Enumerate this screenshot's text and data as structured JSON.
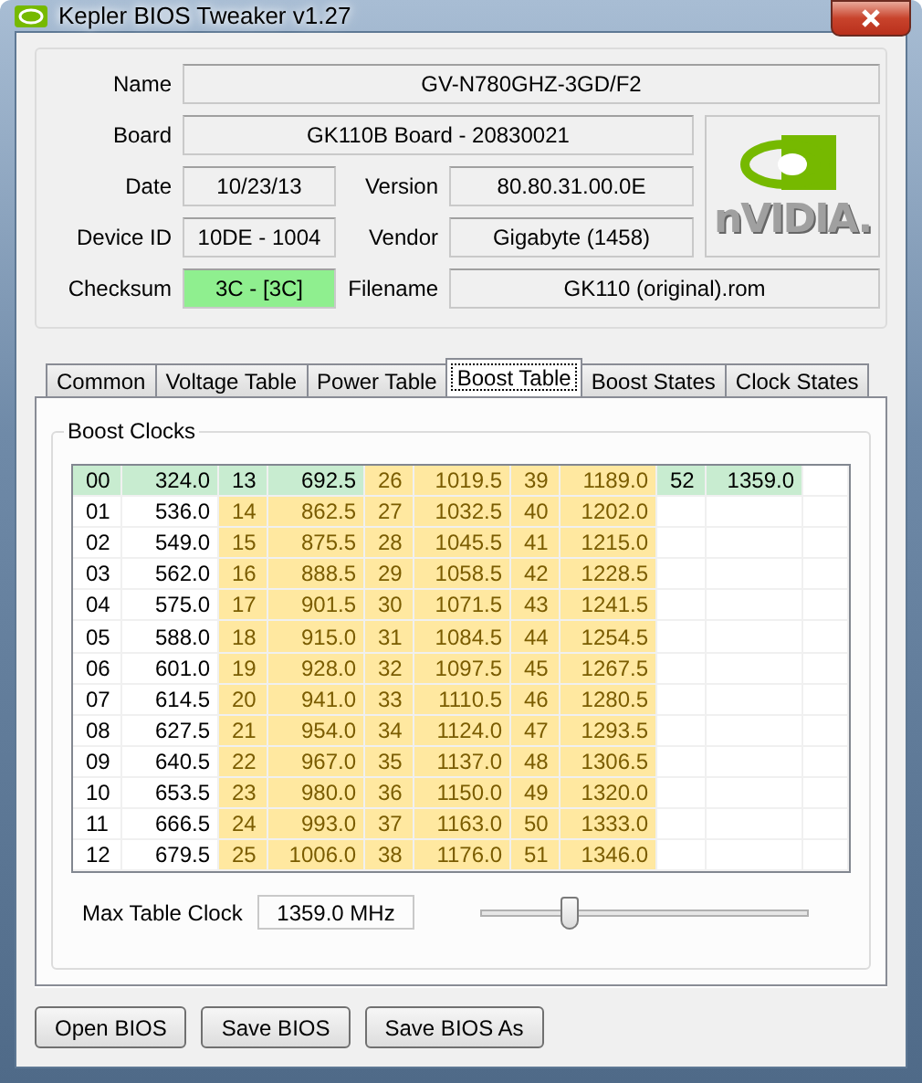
{
  "window": {
    "title": "Kepler BIOS Tweaker v1.27"
  },
  "fields": [
    {
      "label": "Name",
      "value": "GV-N780GHZ-3GD/F2",
      "highlighted": false
    },
    {
      "label": "Board",
      "value": "GK110B Board - 20830021",
      "highlighted": false
    },
    {
      "label": "Date",
      "value": "10/23/13",
      "highlighted": false
    },
    {
      "label": "Version",
      "value": "80.80.31.00.0E",
      "highlighted": false
    },
    {
      "label": "Device ID",
      "value": "10DE - 1004",
      "highlighted": false
    },
    {
      "label": "Vendor",
      "value": "Gigabyte (1458)",
      "highlighted": false
    },
    {
      "label": "Checksum",
      "value": "3C - [3C]",
      "highlighted": true
    },
    {
      "label": "Filename",
      "value": "GK110 (original).rom",
      "highlighted": false
    }
  ],
  "tabs": [
    {
      "label": "Common",
      "selected": false
    },
    {
      "label": "Voltage Table",
      "selected": false
    },
    {
      "label": "Power Table",
      "selected": false
    },
    {
      "label": "Boost Table",
      "selected": true
    },
    {
      "label": "Boost States",
      "selected": false
    },
    {
      "label": "Clock States",
      "selected": false
    }
  ],
  "boost_clocks": {
    "title": "Boost Clocks",
    "rows": [
      {
        "cells": [
          {
            "id": "00",
            "clock": "324.0",
            "color": "#c8ecd0"
          },
          {
            "id": "13",
            "clock": "692.5",
            "color": "#c8ecd0"
          },
          {
            "id": "26",
            "clock": "1019.5",
            "color": "#ffe8a0"
          },
          {
            "id": "39",
            "clock": "1189.0",
            "color": "#ffe8a0"
          },
          {
            "id": "52",
            "clock": "1359.0",
            "color": "#c8ecd0"
          }
        ]
      },
      {
        "cells": [
          {
            "id": "01",
            "clock": "536.0",
            "color": "#ffffff"
          },
          {
            "id": "14",
            "clock": "862.5",
            "color": "#ffe8a0"
          },
          {
            "id": "27",
            "clock": "1032.5",
            "color": "#ffe8a0"
          },
          {
            "id": "40",
            "clock": "1202.0",
            "color": "#ffe8a0"
          }
        ]
      },
      {
        "cells": [
          {
            "id": "02",
            "clock": "549.0",
            "color": "#ffffff"
          },
          {
            "id": "15",
            "clock": "875.5",
            "color": "#ffe8a0"
          },
          {
            "id": "28",
            "clock": "1045.5",
            "color": "#ffe8a0"
          },
          {
            "id": "41",
            "clock": "1215.0",
            "color": "#ffe8a0"
          }
        ]
      },
      {
        "cells": [
          {
            "id": "03",
            "clock": "562.0",
            "color": "#ffffff"
          },
          {
            "id": "16",
            "clock": "888.5",
            "color": "#ffe8a0"
          },
          {
            "id": "29",
            "clock": "1058.5",
            "color": "#ffe8a0"
          },
          {
            "id": "42",
            "clock": "1228.5",
            "color": "#ffe8a0"
          }
        ]
      },
      {
        "cells": [
          {
            "id": "04",
            "clock": "575.0",
            "color": "#ffffff"
          },
          {
            "id": "17",
            "clock": "901.5",
            "color": "#ffe8a0"
          },
          {
            "id": "30",
            "clock": "1071.5",
            "color": "#ffe8a0"
          },
          {
            "id": "43",
            "clock": "1241.5",
            "color": "#ffe8a0"
          }
        ]
      },
      {
        "cells": [
          {
            "id": "05",
            "clock": "588.0",
            "color": "#ffffff"
          },
          {
            "id": "18",
            "clock": "915.0",
            "color": "#ffe8a0"
          },
          {
            "id": "31",
            "clock": "1084.5",
            "color": "#ffe8a0"
          },
          {
            "id": "44",
            "clock": "1254.5",
            "color": "#ffe8a0"
          }
        ]
      },
      {
        "cells": [
          {
            "id": "06",
            "clock": "601.0",
            "color": "#ffffff"
          },
          {
            "id": "19",
            "clock": "928.0",
            "color": "#ffe8a0"
          },
          {
            "id": "32",
            "clock": "1097.5",
            "color": "#ffe8a0"
          },
          {
            "id": "45",
            "clock": "1267.5",
            "color": "#ffe8a0"
          }
        ]
      },
      {
        "cells": [
          {
            "id": "07",
            "clock": "614.5",
            "color": "#ffffff"
          },
          {
            "id": "20",
            "clock": "941.0",
            "color": "#ffe8a0"
          },
          {
            "id": "33",
            "clock": "1110.5",
            "color": "#ffe8a0"
          },
          {
            "id": "46",
            "clock": "1280.5",
            "color": "#ffe8a0"
          }
        ]
      },
      {
        "cells": [
          {
            "id": "08",
            "clock": "627.5",
            "color": "#ffffff"
          },
          {
            "id": "21",
            "clock": "954.0",
            "color": "#ffe8a0"
          },
          {
            "id": "34",
            "clock": "1124.0",
            "color": "#ffe8a0"
          },
          {
            "id": "47",
            "clock": "1293.5",
            "color": "#ffe8a0"
          }
        ]
      },
      {
        "cells": [
          {
            "id": "09",
            "clock": "640.5",
            "color": "#ffffff"
          },
          {
            "id": "22",
            "clock": "967.0",
            "color": "#ffe8a0"
          },
          {
            "id": "35",
            "clock": "1137.0",
            "color": "#ffe8a0"
          },
          {
            "id": "48",
            "clock": "1306.5",
            "color": "#ffe8a0"
          }
        ]
      },
      {
        "cells": [
          {
            "id": "10",
            "clock": "653.5",
            "color": "#ffffff"
          },
          {
            "id": "23",
            "clock": "980.0",
            "color": "#ffe8a0"
          },
          {
            "id": "36",
            "clock": "1150.0",
            "color": "#ffe8a0"
          },
          {
            "id": "49",
            "clock": "1320.0",
            "color": "#ffe8a0"
          }
        ]
      },
      {
        "cells": [
          {
            "id": "11",
            "clock": "666.5",
            "color": "#ffffff"
          },
          {
            "id": "24",
            "clock": "993.0",
            "color": "#ffe8a0"
          },
          {
            "id": "37",
            "clock": "1163.0",
            "color": "#ffe8a0"
          },
          {
            "id": "50",
            "clock": "1333.0",
            "color": "#ffe8a0"
          }
        ]
      },
      {
        "cells": [
          {
            "id": "12",
            "clock": "679.5",
            "color": "#ffffff"
          },
          {
            "id": "25",
            "clock": "1006.0",
            "color": "#ffe8a0"
          },
          {
            "id": "38",
            "clock": "1176.0",
            "color": "#ffe8a0"
          },
          {
            "id": "51",
            "clock": "1346.0",
            "color": "#ffe8a0"
          }
        ]
      }
    ]
  },
  "max_table_clock": {
    "label": "Max Table Clock",
    "value": "1359.0 MHz",
    "level": 0.27
  },
  "logo_text": "nVIDIA.",
  "buttons": [
    "Open BIOS",
    "Save BIOS",
    "Save BIOS As"
  ]
}
